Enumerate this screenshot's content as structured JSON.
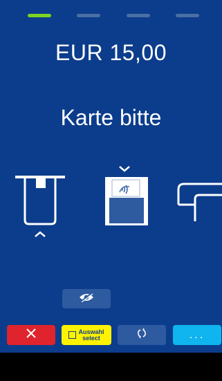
{
  "header": {
    "indicator_colors": [
      "#7ed321",
      "#4a6fa5",
      "#4a6fa5",
      "#4a6fa5"
    ]
  },
  "payment": {
    "amount": "EUR 15,00",
    "prompt": "Karte bitte"
  },
  "card_methods": {
    "chip_icon": "chip-insert-icon",
    "contactless_icon": "contactless-tap-icon",
    "swipe_icon": "magstripe-swipe-icon"
  },
  "privacy": {
    "icon": "eye-slash-icon"
  },
  "toolbar": {
    "cancel_icon": "close-icon",
    "select_line1": "Auswahl",
    "select_line2": "select",
    "reload_icon": "refresh-icon",
    "more_label": "..."
  },
  "colors": {
    "background": "#0c3d8c",
    "cancel": "#e0242d",
    "select": "#fff200",
    "more": "#10b4ee",
    "active_indicator": "#7ed321"
  }
}
